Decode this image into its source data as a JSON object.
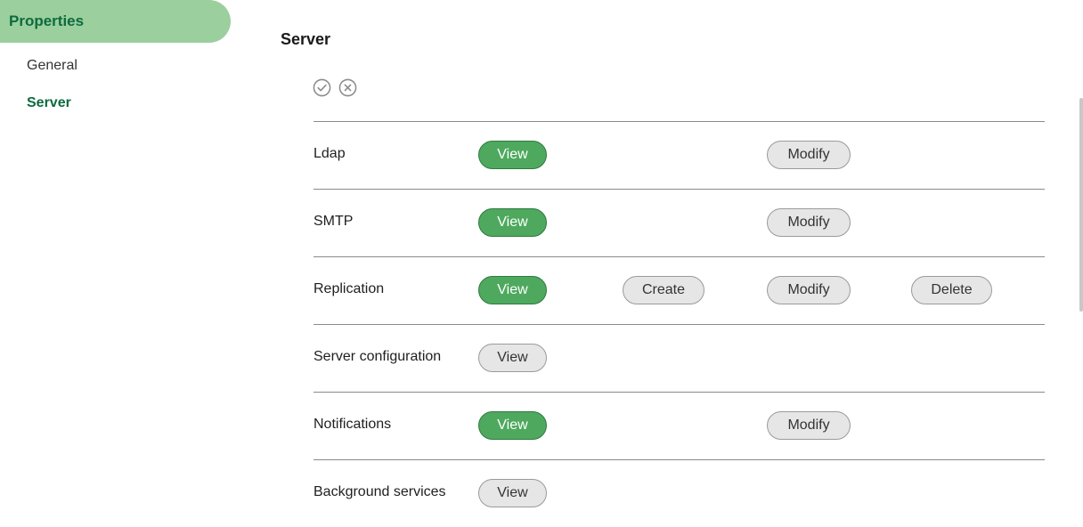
{
  "sidebar": {
    "header": "Properties",
    "items": [
      {
        "label": "General",
        "active": false
      },
      {
        "label": "Server",
        "active": true
      }
    ]
  },
  "main": {
    "title": "Server",
    "icons": [
      "check-circle-icon",
      "close-circle-icon"
    ],
    "rows": [
      {
        "label": "Ldap",
        "view": "View",
        "modify": "Modify"
      },
      {
        "label": "SMTP",
        "view": "View",
        "modify": "Modify"
      },
      {
        "label": "Replication",
        "view": "View",
        "create": "Create",
        "modify": "Modify",
        "delete": "Delete"
      },
      {
        "label": "Server configuration",
        "view": "View"
      },
      {
        "label": "Notifications",
        "view": "View",
        "modify": "Modify"
      },
      {
        "label": "Background services",
        "view": "View"
      }
    ]
  },
  "colors": {
    "accent": "#0d6b3f",
    "sidebar_header_bg": "#9bcf9d",
    "primary_button": "#4ea95e",
    "secondary_button": "#e6e6e6"
  }
}
